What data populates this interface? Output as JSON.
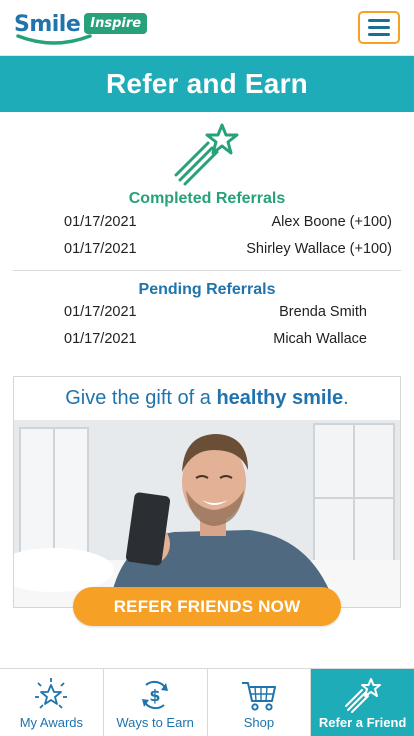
{
  "header": {
    "logo_word": "Smile",
    "logo_badge": "Inspire",
    "menu_icon": "hamburger-menu-icon"
  },
  "page": {
    "title": "Refer and Earn",
    "hero_icon": "shooting-star-icon"
  },
  "completed": {
    "title": "Completed Referrals",
    "rows": [
      {
        "date": "01/17/2021",
        "name": "Alex Boone (+100)"
      },
      {
        "date": "01/17/2021",
        "name": "Shirley Wallace (+100)"
      }
    ]
  },
  "pending": {
    "title": "Pending Referrals",
    "rows": [
      {
        "date": "01/17/2021",
        "name": "Brenda Smith"
      },
      {
        "date": "01/17/2021",
        "name": "Micah Wallace"
      }
    ]
  },
  "promo": {
    "headline_prefix": "Give the gift of a ",
    "headline_bold": "healthy smile",
    "headline_suffix": ".",
    "cta_label": "REFER FRIENDS NOW"
  },
  "nav": {
    "items": [
      {
        "label": "My Awards",
        "icon": "award-star-icon",
        "active": false
      },
      {
        "label": "Ways to Earn",
        "icon": "dollar-cycle-icon",
        "active": false
      },
      {
        "label": "Shop",
        "icon": "shopping-cart-icon",
        "active": false
      },
      {
        "label": "Refer a Friend",
        "icon": "shooting-star-icon",
        "active": true
      }
    ]
  },
  "colors": {
    "teal": "#1eacb8",
    "green": "#26a17a",
    "blue": "#1f74ad",
    "orange": "#f6a126"
  }
}
